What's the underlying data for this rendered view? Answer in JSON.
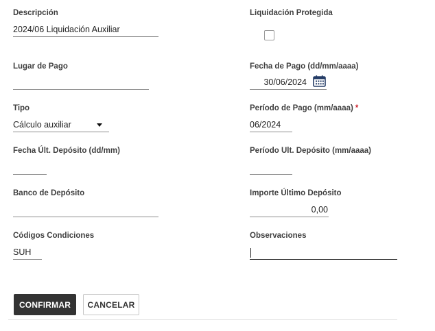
{
  "form": {
    "descripcion": {
      "label": "Descripción",
      "value": "2024/06 Liquidación Auxiliar"
    },
    "liquidacion_protegida": {
      "label": "Liquidación Protegida",
      "checked": false
    },
    "lugar_de_pago": {
      "label": "Lugar de Pago",
      "value": ""
    },
    "fecha_de_pago": {
      "label": "Fecha de Pago (dd/mm/aaaa)",
      "value": "30/06/2024",
      "icon": "calendar-icon"
    },
    "tipo": {
      "label": "Tipo",
      "value": "Cálculo auxiliar",
      "icon": "dropdown-caret-icon"
    },
    "periodo_de_pago": {
      "label": "Período de Pago (mm/aaaa)",
      "required_mark": "*",
      "value": "06/2024"
    },
    "fecha_ult_deposito": {
      "label": "Fecha Últ. Depósito (dd/mm)",
      "value": ""
    },
    "periodo_ult_deposito": {
      "label": "Período Ult. Depósito (mm/aaaa)",
      "value": ""
    },
    "banco_de_deposito": {
      "label": "Banco de Depósito",
      "value": ""
    },
    "importe_ultimo_deposito": {
      "label": "Importe Último Depósito",
      "value": "0,00"
    },
    "codigos_condiciones": {
      "label": "Códigos Condiciones",
      "value": "SUH"
    },
    "observaciones": {
      "label": "Observaciones",
      "value": ""
    }
  },
  "actions": {
    "confirm_label": "CONFIRMAR",
    "cancel_label": "CANCELAR"
  },
  "colors": {
    "primary_button": "#333333",
    "required_asterisk": "#cc1f2a",
    "calendar_icon": "#243c66"
  }
}
